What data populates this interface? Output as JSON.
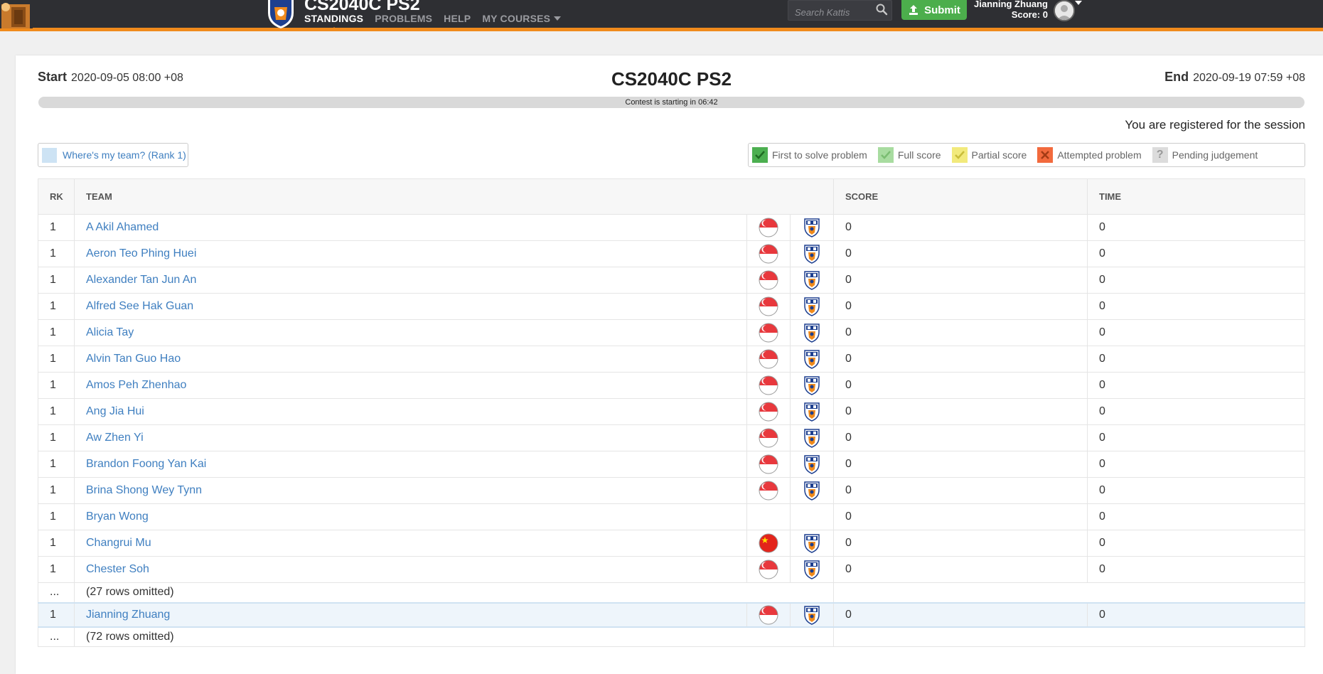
{
  "header": {
    "app_title": "CS2040C PS2",
    "nav": [
      {
        "label": "STANDINGS"
      },
      {
        "label": "PROBLEMS"
      },
      {
        "label": "HELP"
      },
      {
        "label": "MY COURSES"
      }
    ],
    "search_placeholder": "Search Kattis",
    "submit_label": "Submit",
    "user_name": "Jianning Zhuang",
    "user_score": "Score: 0",
    "accent_color": "#f08a1c",
    "submit_color": "#4cae4c"
  },
  "contest": {
    "start_label": "Start",
    "start_value": "2020-09-05 08:00 +08",
    "title": "CS2040C PS2",
    "end_label": "End",
    "end_value": "2020-09-19 07:59 +08",
    "progress_text": "Contest is starting in 06:42",
    "registered_text": "You are registered for the session"
  },
  "where_button": "Where's my team? (Rank 1)",
  "legend": [
    {
      "label": "First to solve problem",
      "color": "#4caf50",
      "icon": "check-icon"
    },
    {
      "label": "Full score",
      "color": "#a8dca0",
      "icon": "check-icon"
    },
    {
      "label": "Partial score",
      "color": "#f2ea7c",
      "icon": "check-icon"
    },
    {
      "label": "Attempted problem",
      "color": "#f26a3d",
      "icon": "x-icon"
    },
    {
      "label": "Pending judgement",
      "color": "#dcdcdc",
      "icon": "question-icon"
    }
  ],
  "table": {
    "headers": {
      "rk": "RK",
      "team": "TEAM",
      "score": "SCORE",
      "time": "TIME"
    },
    "rows": [
      {
        "rk": "1",
        "team": "A Akil Ahamed",
        "flag": "singapore-flag-icon",
        "crest": "university-crest-icon",
        "score": "0",
        "time": "0"
      },
      {
        "rk": "1",
        "team": "Aeron Teo Phing Huei",
        "flag": "singapore-flag-icon",
        "crest": "university-crest-icon",
        "score": "0",
        "time": "0"
      },
      {
        "rk": "1",
        "team": "Alexander Tan Jun An",
        "flag": "singapore-flag-icon",
        "crest": "university-crest-icon",
        "score": "0",
        "time": "0"
      },
      {
        "rk": "1",
        "team": "Alfred See Hak Guan",
        "flag": "singapore-flag-icon",
        "crest": "university-crest-icon",
        "score": "0",
        "time": "0"
      },
      {
        "rk": "1",
        "team": "Alicia Tay",
        "flag": "singapore-flag-icon",
        "crest": "university-crest-icon",
        "score": "0",
        "time": "0"
      },
      {
        "rk": "1",
        "team": "Alvin Tan Guo Hao",
        "flag": "singapore-flag-icon",
        "crest": "university-crest-icon",
        "score": "0",
        "time": "0"
      },
      {
        "rk": "1",
        "team": "Amos Peh Zhenhao",
        "flag": "singapore-flag-icon",
        "crest": "university-crest-icon",
        "score": "0",
        "time": "0"
      },
      {
        "rk": "1",
        "team": "Ang Jia Hui",
        "flag": "singapore-flag-icon",
        "crest": "university-crest-icon",
        "score": "0",
        "time": "0"
      },
      {
        "rk": "1",
        "team": "Aw Zhen Yi",
        "flag": "singapore-flag-icon",
        "crest": "university-crest-icon",
        "score": "0",
        "time": "0"
      },
      {
        "rk": "1",
        "team": "Brandon Foong Yan Kai",
        "flag": "singapore-flag-icon",
        "crest": "university-crest-icon",
        "score": "0",
        "time": "0"
      },
      {
        "rk": "1",
        "team": "Brina Shong Wey Tynn",
        "flag": "singapore-flag-icon",
        "crest": "university-crest-icon",
        "score": "0",
        "time": "0"
      },
      {
        "rk": "1",
        "team": "Bryan Wong",
        "flag": "",
        "crest": "",
        "score": "0",
        "time": "0"
      },
      {
        "rk": "1",
        "team": "Changrui Mu",
        "flag": "china-flag-icon",
        "crest": "university-crest-icon",
        "score": "0",
        "time": "0"
      },
      {
        "rk": "1",
        "team": "Chester Soh",
        "flag": "singapore-flag-icon",
        "crest": "university-crest-icon",
        "score": "0",
        "time": "0"
      }
    ],
    "omitted_1": {
      "rk": "...",
      "text": "(27 rows omitted)"
    },
    "my_row": {
      "rk": "1",
      "team": "Jianning Zhuang",
      "flag": "singapore-flag-icon",
      "crest": "university-crest-icon",
      "score": "0",
      "time": "0"
    },
    "omitted_2": {
      "rk": "...",
      "text": "(72 rows omitted)"
    }
  }
}
